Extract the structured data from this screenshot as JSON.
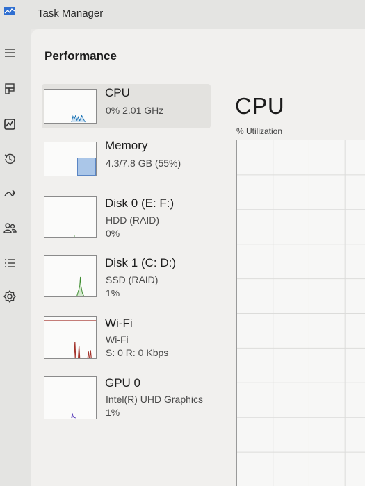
{
  "window": {
    "title": "Task Manager"
  },
  "sidebar": {
    "items": [
      {
        "icon": "hamburger-menu-icon"
      },
      {
        "icon": "processes-icon"
      },
      {
        "icon": "performance-icon"
      },
      {
        "icon": "app-history-icon"
      },
      {
        "icon": "startup-apps-icon"
      },
      {
        "icon": "users-icon"
      },
      {
        "icon": "details-icon"
      },
      {
        "icon": "services-icon"
      }
    ]
  },
  "page": {
    "title": "Performance"
  },
  "resources": [
    {
      "name": "CPU",
      "line1": "0% 2.01 GHz",
      "line2": "",
      "selected": true,
      "color": "#1a73b5"
    },
    {
      "name": "Memory",
      "line1": "4.3/7.8 GB (55%)",
      "line2": "",
      "selected": false,
      "color": "#6b4fa8",
      "level": 0.55
    },
    {
      "name": "Disk 0 (E: F:)",
      "line1": "HDD (RAID)",
      "line2": "0%",
      "selected": false,
      "color": "#3d8c2f"
    },
    {
      "name": "Disk 1 (C: D:)",
      "line1": "SSD (RAID)",
      "line2": "1%",
      "selected": false,
      "color": "#3d8c2f"
    },
    {
      "name": "Wi-Fi",
      "line1": "Wi-Fi",
      "line2": "S: 0 R: 0 Kbps",
      "selected": false,
      "color": "#a3322a"
    },
    {
      "name": "GPU 0",
      "line1": "Intel(R) UHD Graphics",
      "line2": "1%",
      "selected": false,
      "color": "#5a3fb8"
    }
  ],
  "detail": {
    "title": "CPU",
    "subtitle": "% Utilization"
  }
}
